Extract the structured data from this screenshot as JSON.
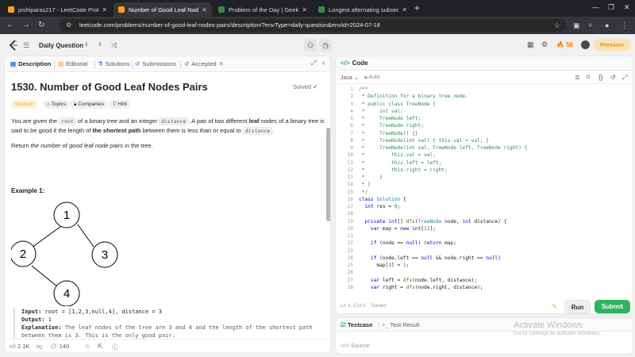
{
  "browser": {
    "tabs": [
      {
        "title": "joshiparas217 - LeetCode Profil",
        "favicon_color": "#ffa116",
        "active": false
      },
      {
        "title": "Number of Good Leaf Nodes P",
        "favicon_color": "#ffa116",
        "active": true
      },
      {
        "title": "Problem of the Day | GeeksforG",
        "favicon_color": "#2f8d46",
        "active": false
      },
      {
        "title": "Longest alternating subseque",
        "favicon_color": "#2f8d46",
        "active": false
      }
    ],
    "new_tab": "+",
    "url": "leetcode.com/problems/number-of-good-leaf-nodes-pairs/description/?envType=daily-question&envId=2024-07-18"
  },
  "lc_nav": {
    "daily_question": "Daily Question",
    "streak_count": "56",
    "premium_label": "Premium"
  },
  "description": {
    "tabs": [
      {
        "label": "Description",
        "icon": "document-icon",
        "active": true
      },
      {
        "label": "Editorial",
        "icon": "book-icon",
        "active": false
      },
      {
        "label": "Solutions",
        "icon": "flask-icon",
        "active": false
      },
      {
        "label": "Submissions",
        "icon": "history-icon",
        "active": false
      },
      {
        "label": "Accepted",
        "icon": "history-icon",
        "active": false
      }
    ],
    "title": "1530. Number of Good Leaf Nodes Pairs",
    "solved_label": "Solved",
    "chips": {
      "difficulty": "Medium",
      "topics": "Topics",
      "companies": "Companies",
      "hint": "Hint"
    },
    "para1": {
      "t1": "You are given the ",
      "c1": "root",
      "t2": " of a binary tree and an integer ",
      "c2": "distance",
      "t3": ". A pair of two different ",
      "b1": "leaf",
      "t4": " nodes of a binary tree is said to be good if the length of ",
      "b2": "the shortest path",
      "t5": " between them is less than or equal to ",
      "c3": "distance",
      "t6": "."
    },
    "para2": {
      "t1": "Return ",
      "i1": "the number of good leaf node pairs",
      "t2": " in the tree."
    },
    "example1_heading": "Example 1:",
    "tree_nodes": [
      "1",
      "2",
      "3",
      "4"
    ],
    "example": {
      "input_label": "Input:",
      "input_value": " root = [1,2,3,null,4], distance = 3",
      "output_label": "Output:",
      "output_value": " 1",
      "explanation_label": "Explanation:",
      "explanation_value": " The leaf nodes of the tree are 3 and 4 and the length of the shortest path between them is 3. This is the only good pair."
    },
    "footer": {
      "likes": "2.1K",
      "comments": "140"
    }
  },
  "editor": {
    "header_title": "Code",
    "language": "Java",
    "auto_label": "Auto",
    "lines": [
      {
        "n": "1",
        "parts": [
          [
            "cmt",
            "/**"
          ]
        ]
      },
      {
        "n": "2",
        "parts": [
          [
            "cmt",
            " * Definition for a binary tree node."
          ]
        ]
      },
      {
        "n": "3",
        "parts": [
          [
            "cmt",
            " * public class TreeNode {"
          ]
        ]
      },
      {
        "n": "4",
        "parts": [
          [
            "cmt",
            " *     int val;"
          ]
        ]
      },
      {
        "n": "5",
        "parts": [
          [
            "cmt",
            " *     TreeNode left;"
          ]
        ]
      },
      {
        "n": "6",
        "parts": [
          [
            "cmt",
            " *     TreeNode right;"
          ]
        ]
      },
      {
        "n": "7",
        "parts": [
          [
            "cmt",
            " *     TreeNode() {}"
          ]
        ]
      },
      {
        "n": "8",
        "parts": [
          [
            "cmt",
            " *     TreeNode(int val) { this.val = val; }"
          ]
        ]
      },
      {
        "n": "9",
        "parts": [
          [
            "cmt",
            " *     TreeNode(int val, TreeNode left, TreeNode right) {"
          ]
        ]
      },
      {
        "n": "10",
        "parts": [
          [
            "cmt",
            " *         this.val = val;"
          ]
        ]
      },
      {
        "n": "11",
        "parts": [
          [
            "cmt",
            " *         this.left = left;"
          ]
        ]
      },
      {
        "n": "12",
        "parts": [
          [
            "cmt",
            " *         this.right = right;"
          ]
        ]
      },
      {
        "n": "13",
        "parts": [
          [
            "cmt",
            " *     }"
          ]
        ]
      },
      {
        "n": "14",
        "parts": [
          [
            "cmt",
            " * }"
          ]
        ]
      },
      {
        "n": "15",
        "parts": [
          [
            "cmt",
            " */"
          ]
        ]
      },
      {
        "n": "16",
        "parts": [
          [
            "kw",
            "class "
          ],
          [
            "ty",
            "Solution"
          ],
          [
            "",
            " {"
          ]
        ]
      },
      {
        "n": "17",
        "parts": [
          [
            "",
            "  "
          ],
          [
            "kw",
            "int"
          ],
          [
            "",
            " res = "
          ],
          [
            "num",
            "0"
          ],
          [
            "",
            ";"
          ]
        ]
      },
      {
        "n": "18",
        "parts": [
          [
            "",
            ""
          ]
        ]
      },
      {
        "n": "19",
        "parts": [
          [
            "",
            "  "
          ],
          [
            "kw",
            "private int"
          ],
          [
            "",
            "[] "
          ],
          [
            "fn",
            "dfs"
          ],
          [
            "",
            "("
          ],
          [
            "ty",
            "TreeNode"
          ],
          [
            "",
            " node, "
          ],
          [
            "kw",
            "int"
          ],
          [
            "",
            " distance) {"
          ]
        ]
      },
      {
        "n": "20",
        "parts": [
          [
            "",
            "    "
          ],
          [
            "kw",
            "var"
          ],
          [
            "",
            " map = "
          ],
          [
            "kw",
            "new int"
          ],
          [
            "",
            "["
          ],
          [
            "num",
            "11"
          ],
          [
            "",
            "];"
          ]
        ]
      },
      {
        "n": "21",
        "parts": [
          [
            "",
            ""
          ]
        ]
      },
      {
        "n": "22",
        "parts": [
          [
            "",
            "    "
          ],
          [
            "kw",
            "if"
          ],
          [
            "",
            " (node == "
          ],
          [
            "kw",
            "null"
          ],
          [
            "",
            ") "
          ],
          [
            "kw",
            "return"
          ],
          [
            "",
            " map;"
          ]
        ]
      },
      {
        "n": "23",
        "parts": [
          [
            "",
            ""
          ]
        ]
      },
      {
        "n": "24",
        "parts": [
          [
            "",
            "    "
          ],
          [
            "kw",
            "if"
          ],
          [
            "",
            " (node.left == "
          ],
          [
            "kw",
            "null"
          ],
          [
            "",
            " && node.right == "
          ],
          [
            "kw",
            "null"
          ],
          [
            "",
            ")"
          ]
        ]
      },
      {
        "n": "25",
        "parts": [
          [
            "",
            "      map["
          ],
          [
            "num",
            "1"
          ],
          [
            "",
            "] = "
          ],
          [
            "num",
            "1"
          ],
          [
            "",
            ";"
          ]
        ]
      },
      {
        "n": "26",
        "parts": [
          [
            "",
            ""
          ]
        ]
      },
      {
        "n": "27",
        "parts": [
          [
            "",
            "    "
          ],
          [
            "kw",
            "var"
          ],
          [
            "",
            " left = "
          ],
          [
            "fn",
            "dfs"
          ],
          [
            "",
            "(node.left, distance);"
          ]
        ]
      },
      {
        "n": "28",
        "parts": [
          [
            "",
            "    "
          ],
          [
            "kw",
            "var"
          ],
          [
            "",
            " right = "
          ],
          [
            "fn",
            "dfs"
          ],
          [
            "",
            "(node.right, distance);"
          ]
        ]
      }
    ],
    "cursor_pos": "Ln 1, Col 1",
    "saved_label": "Saved",
    "run_label": "Run",
    "submit_label": "Submit"
  },
  "testcase": {
    "tab1": "Testcase",
    "tab2": "Test Result",
    "source_label": "Source"
  },
  "watermark": {
    "title": "Activate Windows",
    "subtitle": "Go to Settings to activate Windows."
  }
}
